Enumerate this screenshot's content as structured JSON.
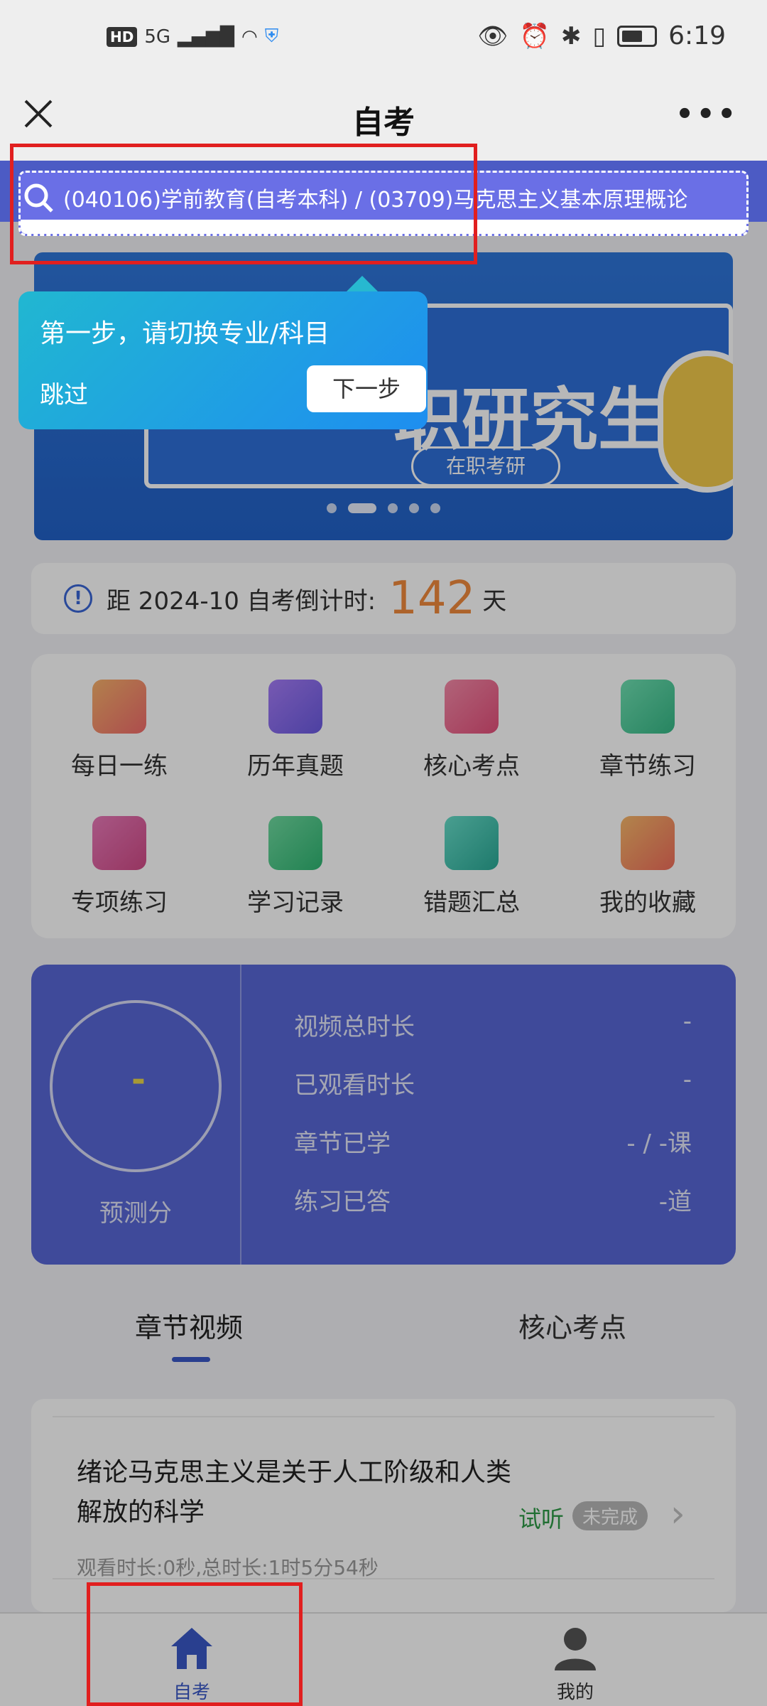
{
  "status_bar": {
    "hd": "HD",
    "network": "5G",
    "time": "6:19"
  },
  "title_bar": {
    "title": "自考",
    "close_icon": "close-icon",
    "more_icon": "more-icon"
  },
  "search": {
    "text": "(040106)学前教育(自考本科) / (03709)马克思主义基本原理概论",
    "icon": "search-icon"
  },
  "tooltip": {
    "text": "第一步，请切换专业/科目",
    "skip": "跳过",
    "next": "下一步"
  },
  "banner": {
    "headline": "职研究生",
    "sub": "在职考研",
    "dots": 5,
    "active_dot": 1
  },
  "countdown": {
    "label": "距 2024-10 自考倒计时:",
    "days": "142",
    "unit": "天"
  },
  "menu": [
    {
      "label": "每日一练",
      "icon": "pencil-icon",
      "color": "#f07b6c"
    },
    {
      "label": "历年真题",
      "icon": "exam-icon",
      "color": "#8b5cf6"
    },
    {
      "label": "核心考点",
      "icon": "book-icon",
      "color": "#f0648a"
    },
    {
      "label": "章节练习",
      "icon": "folder-up-icon",
      "color": "#4fcf9a"
    },
    {
      "label": "专项练习",
      "icon": "document-icon",
      "color": "#e0609a"
    },
    {
      "label": "学习记录",
      "icon": "folder-icon",
      "color": "#48c78e"
    },
    {
      "label": "错题汇总",
      "icon": "wrong-icon",
      "color": "#3cc8b0"
    },
    {
      "label": "我的收藏",
      "icon": "star-bookmark-icon",
      "color": "#f29b4a"
    }
  ],
  "stats": {
    "score_value": "-",
    "score_label": "预测分",
    "rows": [
      {
        "label": "视频总时长",
        "value": "-"
      },
      {
        "label": "已观看时长",
        "value": "-"
      },
      {
        "label": "章节已学",
        "value": "- / -课"
      },
      {
        "label": "练习已答",
        "value": "-道"
      }
    ]
  },
  "tabs": {
    "active": "章节视频",
    "inactive": "核心考点"
  },
  "lesson": {
    "title": "绪论马克思主义是关于人工阶级和人类解放的科学",
    "meta": "观看时长:0秒,总时长:1时5分54秒",
    "trial": "试听",
    "status": "未完成"
  },
  "bottom_nav": {
    "home_label": "自考",
    "profile_label": "我的"
  },
  "colors": {
    "accent": "#3a58c7",
    "search_band": "#4c5bc4",
    "countdown_number": "#f08a3c",
    "annotation": "#e11f1f"
  }
}
